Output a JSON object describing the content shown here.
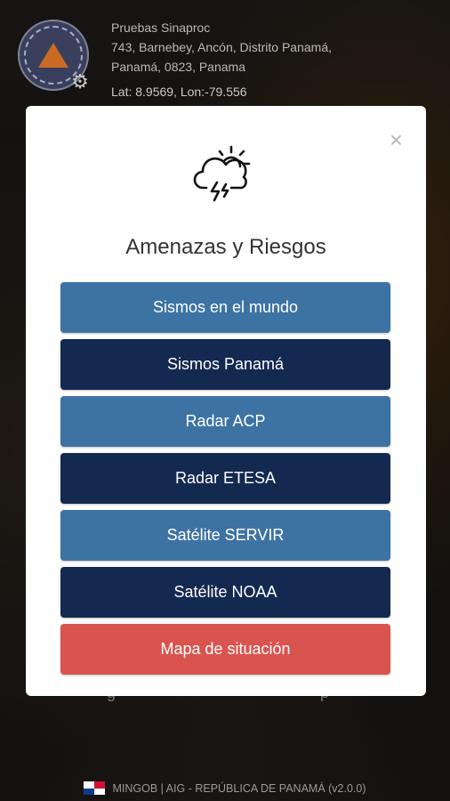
{
  "header": {
    "name": "Pruebas Sinaproc",
    "address_line1": "743, Barnebey, Ancón, Distrito Panamá,",
    "address_line2": "Panamá, 0823, Panama",
    "coordinates": "Lat: 8.9569, Lon:-79.556"
  },
  "modal": {
    "title": "Amenazas y Riesgos",
    "close_label": "×",
    "icon": "storm-cloud-sun-icon",
    "buttons": [
      {
        "label": "Sismos en el mundo",
        "style": "light",
        "color": "#3d73a3"
      },
      {
        "label": "Sismos Panamá",
        "style": "dark",
        "color": "#13294f"
      },
      {
        "label": "Radar ACP",
        "style": "light",
        "color": "#3d73a3"
      },
      {
        "label": "Radar ETESA",
        "style": "dark",
        "color": "#13294f"
      },
      {
        "label": "Satélite SERVIR",
        "style": "light",
        "color": "#3d73a3"
      },
      {
        "label": "Satélite NOAA",
        "style": "dark",
        "color": "#13294f"
      },
      {
        "label": "Mapa de situación",
        "style": "red",
        "color": "#d9534f"
      }
    ]
  },
  "footer": {
    "text": "MINGOB | AIG - REPÚBLICA DE PANAMÁ (v2.0.0)"
  }
}
